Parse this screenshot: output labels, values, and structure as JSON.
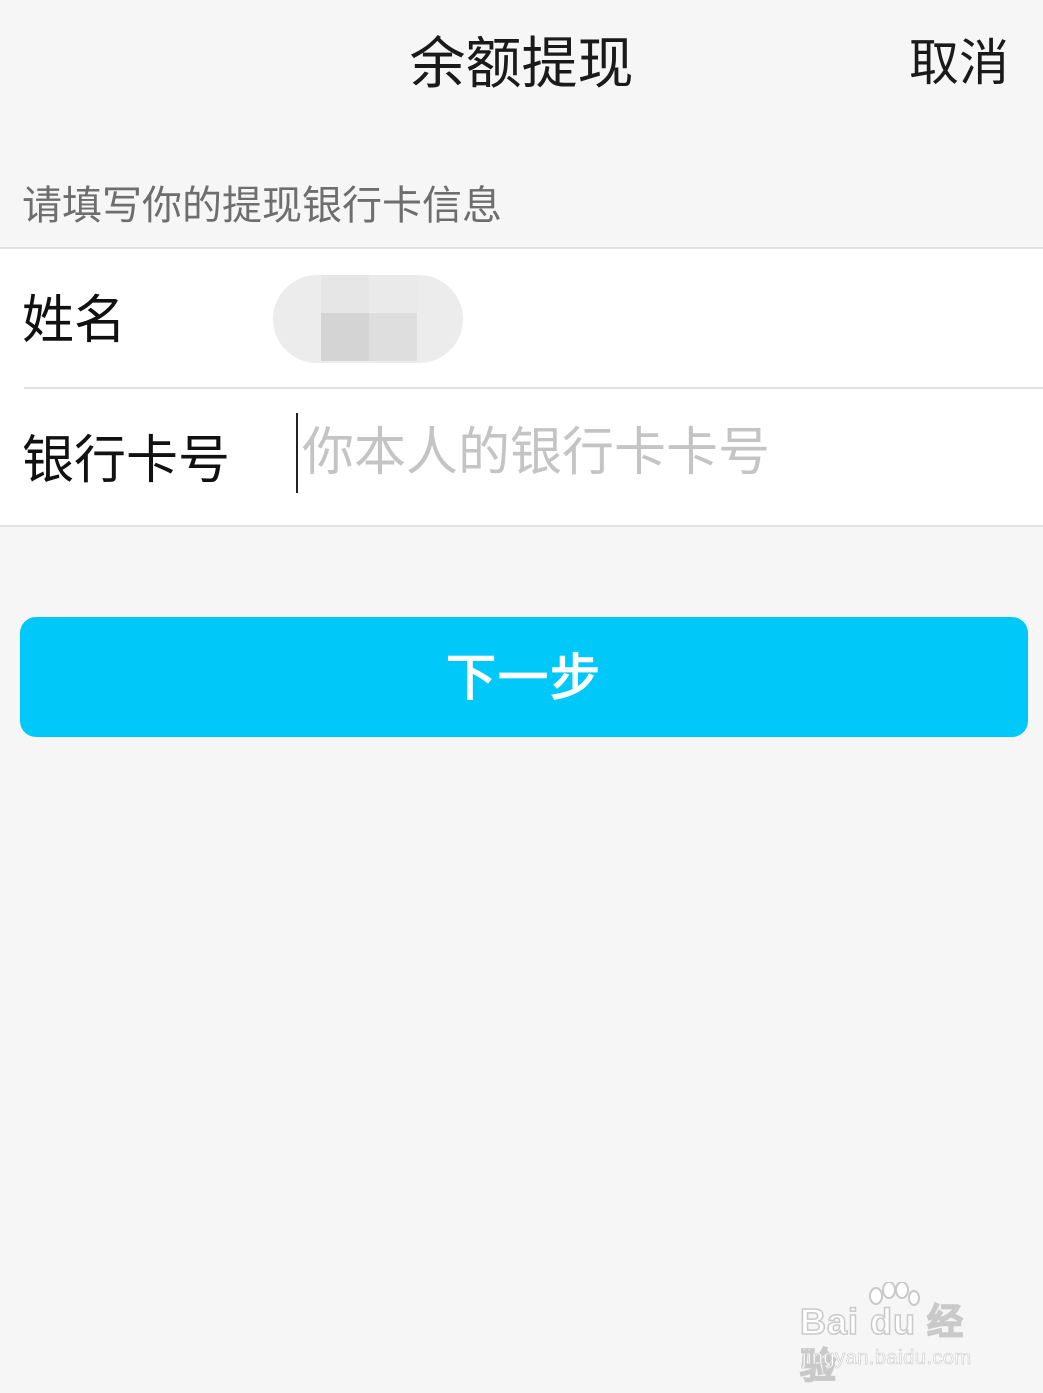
{
  "header": {
    "title": "余额提现",
    "cancel_label": "取消"
  },
  "form": {
    "hint": "请填写你的提现银行卡信息",
    "name_label": "姓名",
    "card_label": "银行卡号",
    "card_placeholder": "你本人的银行卡卡号",
    "card_value": ""
  },
  "actions": {
    "next_label": "下一步",
    "next_color": "#00c8f8"
  },
  "watermark": {
    "logo_text": "Bai du 经验",
    "url": "jingyan.baidu.com"
  }
}
